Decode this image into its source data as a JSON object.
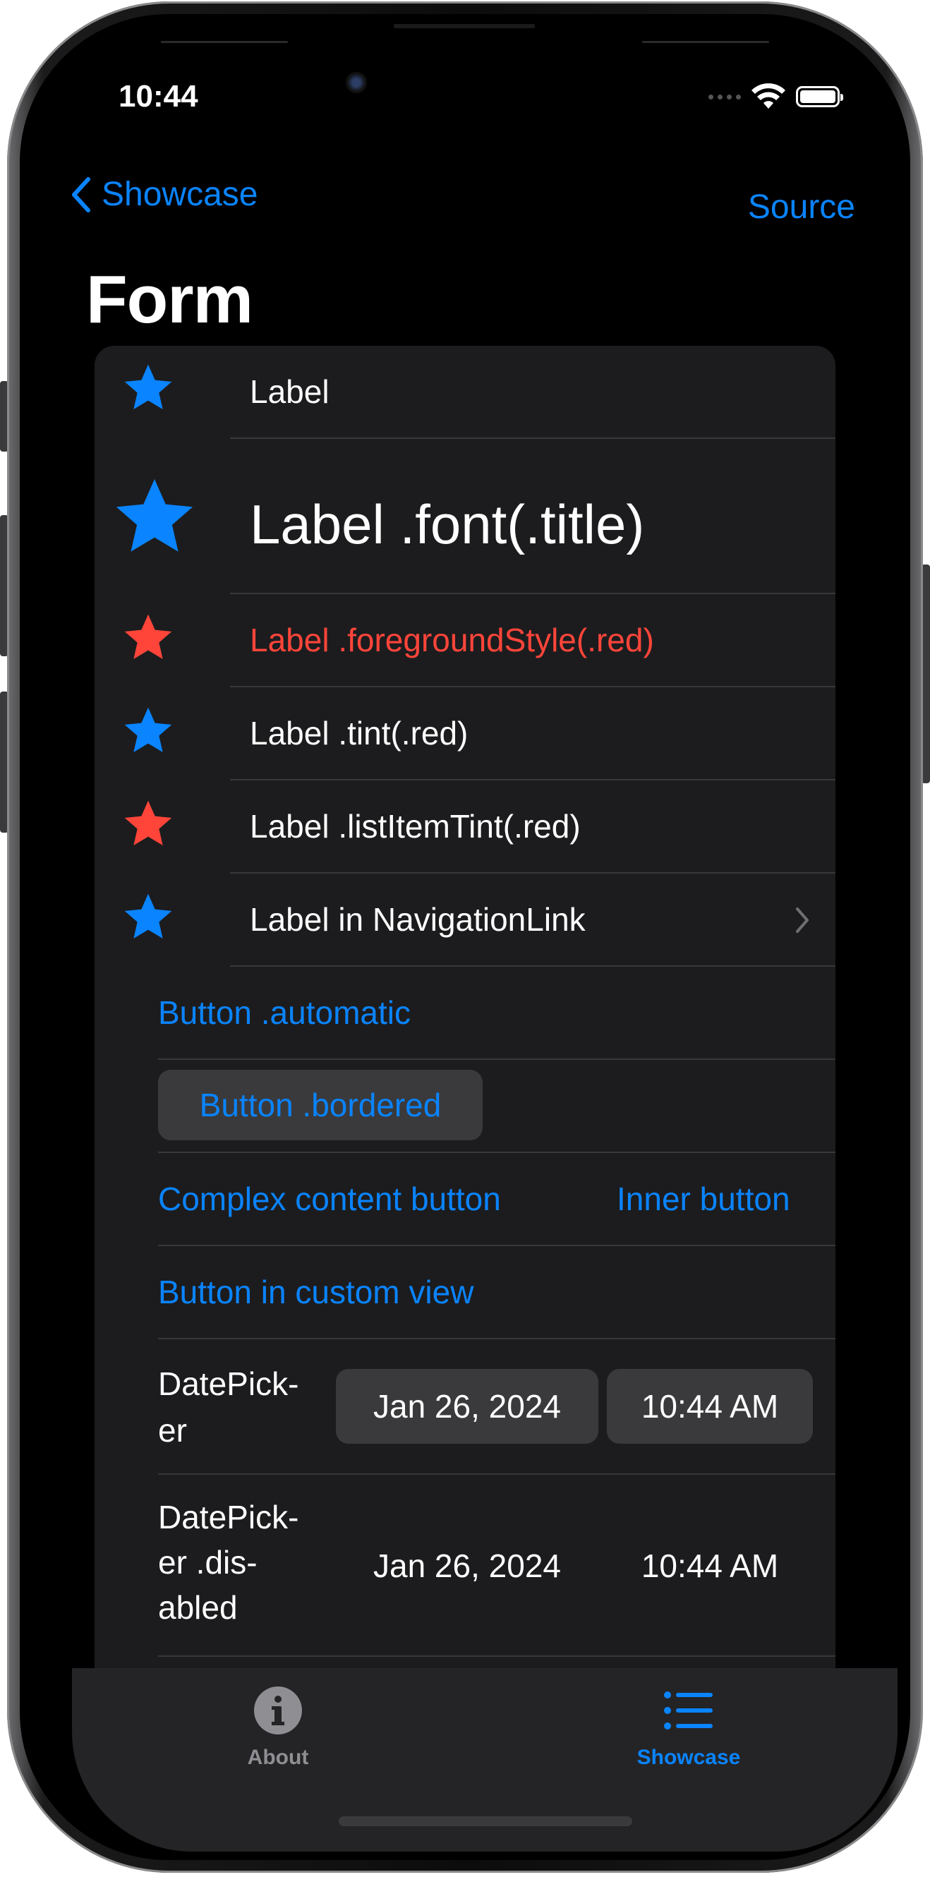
{
  "status": {
    "time": "10:44"
  },
  "nav": {
    "back_label": "Showcase",
    "action_label": "Source",
    "title": "Form"
  },
  "rows": {
    "label": "Label",
    "label_title": "Label .font(.title)",
    "label_foreground": "Label .foregroundStyle(.red)",
    "label_tint": "Label .tint(.red)",
    "label_list_item_tint": "Label .listItemTint(.red)",
    "label_nav_link": "Label in NavigationLink",
    "button_automatic": "Button .automatic",
    "button_bordered": "Button .bordered",
    "complex_button": "Complex content button",
    "inner_button": "Inner button",
    "custom_view_button": "Button in custom view",
    "datepicker_label": "DatePick-\ner",
    "datepicker_date": "Jan 26, 2024",
    "datepicker_time": "10:44 AM",
    "datepicker_disabled_label": "DatePick-\ner .dis-\nabled",
    "datepicker_disabled_date": "Jan 26, 2024",
    "datepicker_disabled_time": "10:44 AM"
  },
  "tabs": [
    {
      "label": "About",
      "icon": "info-circle-icon",
      "selected": false
    },
    {
      "label": "Showcase",
      "icon": "list-bullet-icon",
      "selected": true
    }
  ],
  "colors": {
    "accent": "#0a84ff",
    "red": "#ff453a",
    "background": "#000000",
    "card": "#1c1c1e"
  }
}
